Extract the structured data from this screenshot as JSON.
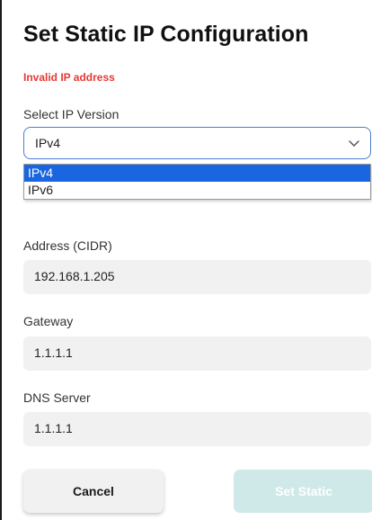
{
  "title": "Set Static IP Configuration",
  "error": "Invalid IP address",
  "ip_version": {
    "label": "Select IP Version",
    "selected": "IPv4",
    "options": [
      "IPv4",
      "IPv6"
    ]
  },
  "address": {
    "label": "Address (CIDR)",
    "value": "192.168.1.205"
  },
  "gateway": {
    "label": "Gateway",
    "value": "1.1.1.1"
  },
  "dns": {
    "label": "DNS Server",
    "value": "1.1.1.1"
  },
  "buttons": {
    "cancel": "Cancel",
    "set_static": "Set Static"
  },
  "colors": {
    "error": "#e53935",
    "selected_option": "#1a66e0",
    "select_border": "#4a7fd0",
    "set_static_disabled": "#cfe9e9"
  },
  "icons": {
    "dropdown": "chevron-down-icon"
  }
}
